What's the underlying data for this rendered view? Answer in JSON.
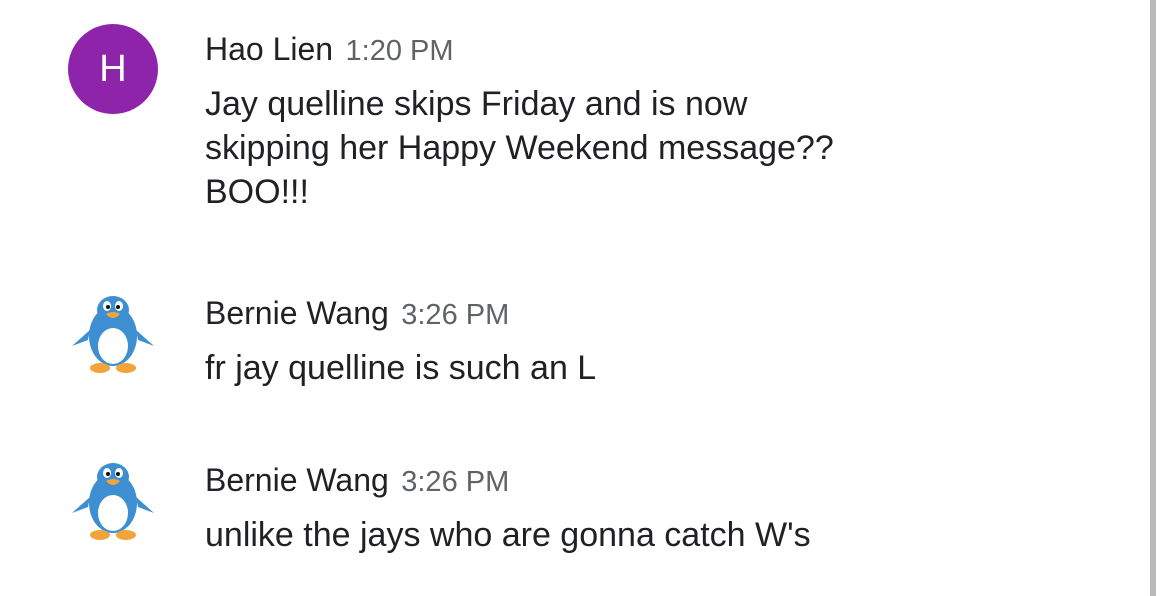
{
  "colors": {
    "avatar_purple": "#8e24aa",
    "penguin_blue": "#3e8fd1",
    "text_primary": "#202124",
    "text_secondary": "#5f6368"
  },
  "messages": [
    {
      "avatar_type": "letter",
      "avatar_letter": "H",
      "sender": "Hao Lien",
      "time": "1:20 PM",
      "text": "Jay quelline skips Friday and is now\nskipping her Happy Weekend message??\nBOO!!!"
    },
    {
      "avatar_type": "penguin-icon",
      "sender": "Bernie Wang",
      "time": "3:26 PM",
      "text": "fr jay quelline is such an L"
    },
    {
      "avatar_type": "penguin-icon",
      "sender": "Bernie Wang",
      "time": "3:26 PM",
      "text": "unlike the jays who are gonna catch W's"
    }
  ]
}
